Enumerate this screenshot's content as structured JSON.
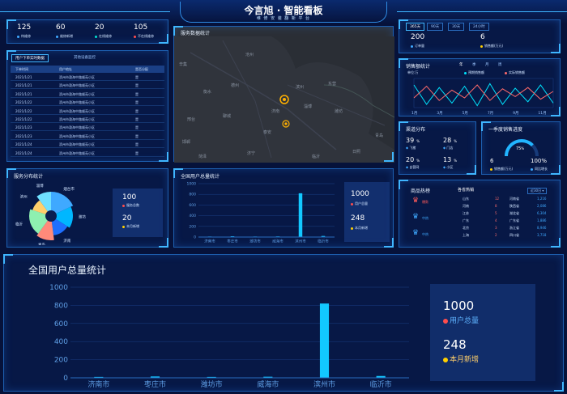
{
  "header": {
    "title": "今言旭 · 智能看板",
    "subtitle": "维 修 安 装 翻 新 平 台"
  },
  "top_stats": [
    {
      "value": "125",
      "label": "待维修",
      "color": "#3fa9ff"
    },
    {
      "value": "60",
      "label": "维修新增",
      "color": "#3fa9ff"
    },
    {
      "value": "20",
      "label": "在线维修",
      "color": "#00e0d0"
    },
    {
      "value": "105",
      "label": "不在线维修",
      "color": "#ff4d4d"
    }
  ],
  "orders": {
    "tabs": [
      "用户下单实时数据",
      "其他设备监控"
    ],
    "columns": [
      "下单时间",
      "用户地址",
      "是否分配"
    ],
    "rows": [
      [
        "2021/1/21",
        "滨州市渤海中路顺苑小区",
        "是"
      ],
      [
        "2021/1/21",
        "滨州市渤海中路顺苑小区",
        "是"
      ],
      [
        "2021/1/21",
        "滨州市渤海中路顺苑小区",
        "是"
      ],
      [
        "2021/1/22",
        "滨州市渤海中路顺苑小区",
        "是"
      ],
      [
        "2021/1/22",
        "滨州市渤海中路顺苑小区",
        "是"
      ],
      [
        "2021/1/22",
        "滨州市渤海中路顺苑小区",
        "是"
      ],
      [
        "2021/1/23",
        "滨州市渤海中路顺苑小区",
        "是"
      ],
      [
        "2021/1/23",
        "滨州市渤海中路顺苑小区",
        "是"
      ],
      [
        "2021/1/24",
        "滨州市渤海中路顺苑小区",
        "是"
      ],
      [
        "2021/1/24",
        "滨州市渤海中路顺苑小区",
        "是"
      ]
    ]
  },
  "map": {
    "title": "服务数据统计",
    "labels": [
      "沧州",
      "辛集",
      "德州",
      "衡水",
      "邢台",
      "滨州",
      "东营",
      "潍坊",
      "济南",
      "淄博",
      "泰安",
      "青岛",
      "临沂",
      "日照",
      "济宁",
      "菏泽",
      "聊城",
      "邯郸"
    ]
  },
  "sales_summary": {
    "tabs": [
      "365天",
      "90天",
      "30天",
      "24小时"
    ],
    "orders_value": "200",
    "orders_label": "订单量",
    "sales_value": "6",
    "sales_label": "销售额(万元)"
  },
  "sales_line": {
    "title": "销售额统计",
    "tabs": [
      "年",
      "季",
      "月",
      "周"
    ],
    "unit": "单位:万",
    "legend": [
      "预期销售额",
      "实际销售额"
    ],
    "xticks": [
      "1月",
      "3月",
      "5月",
      "7月",
      "9月",
      "11月"
    ]
  },
  "channels": {
    "title": "渠道分布",
    "items": [
      {
        "value": "39",
        "unit": "%",
        "label": "飞猪"
      },
      {
        "value": "28",
        "unit": "%",
        "label": "门店"
      },
      {
        "value": "20",
        "unit": "%",
        "label": "自营网"
      },
      {
        "value": "13",
        "unit": "%",
        "label": "小区"
      }
    ]
  },
  "quarter": {
    "title": "一季度销售进度",
    "percent": "75",
    "pct_sign": "%",
    "left_val": "6",
    "left_label": "销售额(万元)",
    "right_val": "100%",
    "right_label": "同比增长"
  },
  "hot": {
    "title": "商品热榜",
    "sub": "各省热销",
    "region": "近30日",
    "tiers": [
      "爆款",
      "中热",
      "中热"
    ],
    "prov": [
      [
        "山东",
        "12"
      ],
      [
        "河南",
        "8"
      ],
      [
        "江苏",
        "5"
      ],
      [
        "广东",
        "4"
      ],
      [
        "北京",
        "3"
      ],
      [
        "上海",
        "2"
      ]
    ],
    "rank": [
      [
        "河南省",
        "1,216"
      ],
      [
        "陕西省",
        "2,086"
      ],
      [
        "湖北省",
        "6,304"
      ],
      [
        "广东省",
        "1,886"
      ],
      [
        "浙江省",
        "8,946"
      ],
      [
        "四川省",
        "3,718"
      ]
    ]
  },
  "service_dist": {
    "title": "服务分布统计",
    "legend": [
      "服务总数",
      "本月新增"
    ],
    "total": "100",
    "new": "20",
    "slices": [
      {
        "name": "烟台市",
        "value": 18,
        "color": "#3fa9ff"
      },
      {
        "name": "潍坊",
        "value": 16,
        "color": "#00b7ff"
      },
      {
        "name": "济南",
        "value": 14,
        "color": "#1e6fff"
      },
      {
        "name": "青岛",
        "value": 12,
        "color": "#ff8a7a"
      },
      {
        "name": "临沂",
        "value": 20,
        "color": "#8ef0b0"
      },
      {
        "name": "滨州",
        "value": 10,
        "color": "#ffcf6b"
      },
      {
        "name": "淄博",
        "value": 10,
        "color": "#6fe0ff"
      }
    ]
  },
  "user_small": {
    "title": "全国用户总量统计",
    "total_value": "1000",
    "total_label": "用户总量",
    "new_value": "248",
    "new_label": "本月新增"
  },
  "user_big": {
    "title": "全国用户总量统计",
    "total_value": "1000",
    "total_label": "用户总量",
    "new_value": "248",
    "new_label": "本月新增"
  },
  "chart_data": {
    "type": "bar",
    "categories": [
      "济南市",
      "枣庄市",
      "潍坊市",
      "威海市",
      "滨州市",
      "临沂市"
    ],
    "series": [
      {
        "values": [
          10,
          15,
          10,
          12,
          820,
          20
        ]
      }
    ],
    "ylim": [
      0,
      1000
    ],
    "yticks": [
      0,
      200,
      400,
      600,
      800,
      1000
    ]
  }
}
